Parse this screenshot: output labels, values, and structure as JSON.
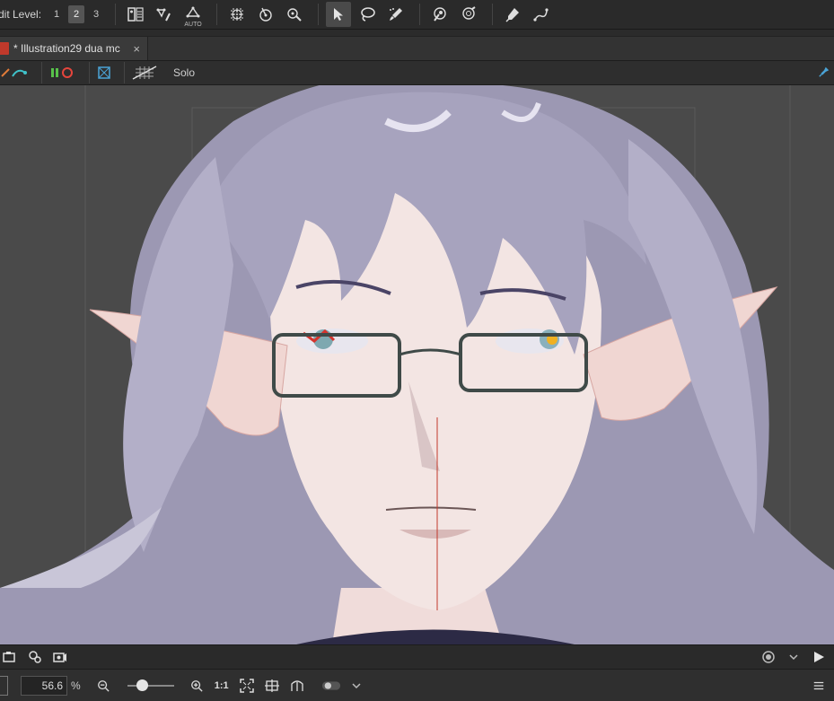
{
  "toolbar": {
    "edit_level_label": "dit Level:",
    "levels": [
      "1",
      "2",
      "3"
    ],
    "active_level": "2",
    "auto_label": "AUTO"
  },
  "tab": {
    "title": "* Illustration29 dua mc",
    "close": "×"
  },
  "subbar": {
    "solo_label": "Solo"
  },
  "zoom": {
    "value": "56.6",
    "unit": "%",
    "ratio_label": "1:1"
  },
  "colors": {
    "toolbar_bg": "#2a2a2a",
    "canvas_bg": "#4a4a4a",
    "active_tool": "#4a4a4a",
    "tab_icon": "#c0392b",
    "hair": "#a7a3be",
    "skin": "#f3e5e3"
  }
}
